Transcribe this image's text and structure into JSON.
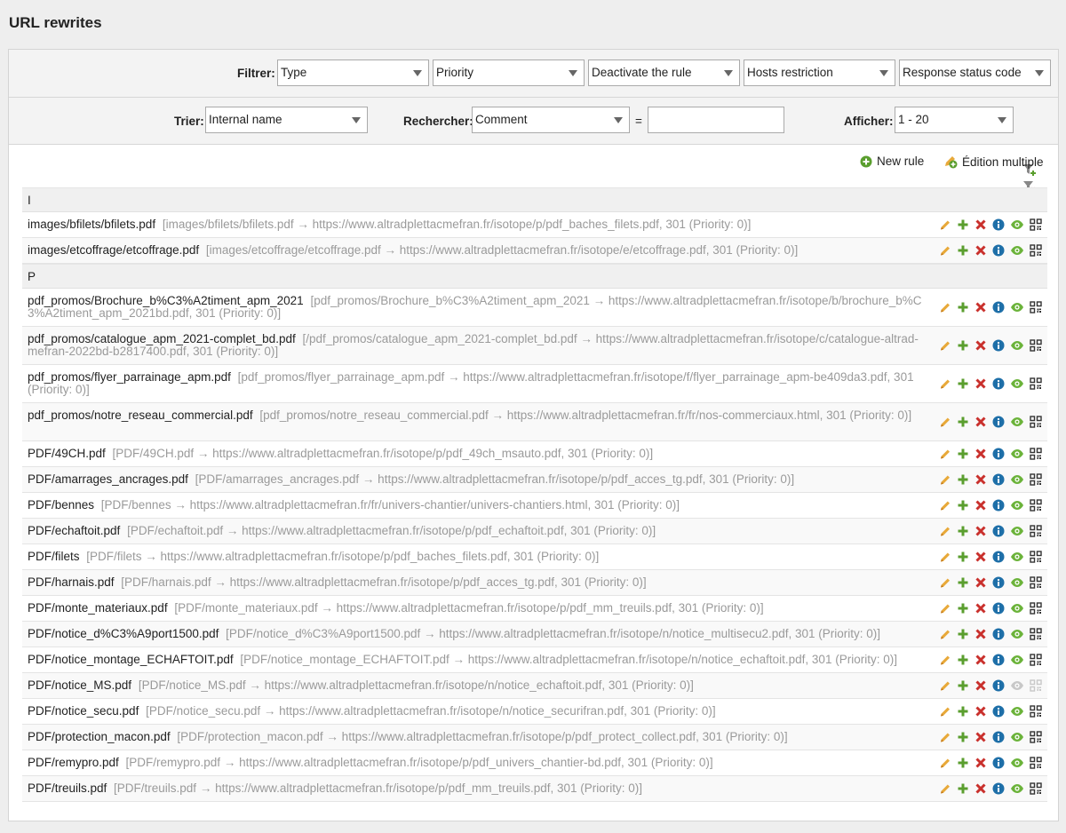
{
  "page": {
    "title": "URL rewrites"
  },
  "filter": {
    "label": "Filtrer:",
    "type": "Type",
    "priority": "Priority",
    "deactivate": "Deactivate the rule",
    "hosts": "Hosts restriction",
    "status": "Response status code"
  },
  "sortbar": {
    "sort_label": "Trier:",
    "sort_value": "Internal name",
    "search_label": "Rechercher:",
    "search_field": "Comment",
    "equals": "=",
    "search_value": "",
    "show_label": "Afficher:",
    "show_value": "1 - 20"
  },
  "actions": {
    "new_rule": "New rule",
    "multi_edit": "Édition multiple"
  },
  "groups": [
    {
      "header": "I",
      "rows": [
        {
          "src": "images/bfilets/bfilets.pdf",
          "desc": "[images/bfilets/bfilets.pdf → https://www.altradplettacmefran.fr/isotope/p/pdf_baches_filets.pdf, 301 (Priority: 0)]"
        },
        {
          "src": "images/etcoffrage/etcoffrage.pdf",
          "desc": "[images/etcoffrage/etcoffrage.pdf → https://www.altradplettacmefran.fr/isotope/e/etcoffrage.pdf, 301 (Priority: 0)]"
        }
      ]
    },
    {
      "header": "P",
      "rows": [
        {
          "src": "pdf_promos/Brochure_b%C3%A2timent_apm_2021",
          "desc": "[pdf_promos/Brochure_b%C3%A2timent_apm_2021 → https://www.altradplettacmefran.fr/isotope/b/brochure_b%C3%A2timent_apm_2021bd.pdf, 301 (Priority: 0)]"
        },
        {
          "src": "pdf_promos/catalogue_apm_2021-complet_bd.pdf",
          "desc": "[/pdf_promos/catalogue_apm_2021-complet_bd.pdf → https://www.altradplettacmefran.fr/isotope/c/catalogue-altrad-mefran-2022bd-b2817400.pdf, 301 (Priority: 0)]"
        },
        {
          "src": "pdf_promos/flyer_parrainage_apm.pdf",
          "desc": "[pdf_promos/flyer_parrainage_apm.pdf → https://www.altradplettacmefran.fr/isotope/f/flyer_parrainage_apm-be409da3.pdf, 301 (Priority: 0)]"
        },
        {
          "src": "pdf_promos/notre_reseau_commercial.pdf",
          "desc": "[pdf_promos/notre_reseau_commercial.pdf → https://www.altradplettacmefran.fr/fr/nos-commerciaux.html, 301 (Priority: 0)]"
        },
        {
          "src": "PDF/49CH.pdf",
          "desc": "[PDF/49CH.pdf → https://www.altradplettacmefran.fr/isotope/p/pdf_49ch_msauto.pdf, 301 (Priority: 0)]"
        },
        {
          "src": "PDF/amarrages_ancrages.pdf",
          "desc": "[PDF/amarrages_ancrages.pdf → https://www.altradplettacmefran.fr/isotope/p/pdf_acces_tg.pdf, 301 (Priority: 0)]"
        },
        {
          "src": "PDF/bennes",
          "desc": "[PDF/bennes → https://www.altradplettacmefran.fr/fr/univers-chantier/univers-chantiers.html, 301 (Priority: 0)]"
        },
        {
          "src": "PDF/echaftoit.pdf",
          "desc": "[PDF/echaftoit.pdf → https://www.altradplettacmefran.fr/isotope/p/pdf_echaftoit.pdf, 301 (Priority: 0)]"
        },
        {
          "src": "PDF/filets",
          "desc": "[PDF/filets → https://www.altradplettacmefran.fr/isotope/p/pdf_baches_filets.pdf, 301 (Priority: 0)]"
        },
        {
          "src": "PDF/harnais.pdf",
          "desc": "[PDF/harnais.pdf → https://www.altradplettacmefran.fr/isotope/p/pdf_acces_tg.pdf, 301 (Priority: 0)]"
        },
        {
          "src": "PDF/monte_materiaux.pdf",
          "desc": "[PDF/monte_materiaux.pdf → https://www.altradplettacmefran.fr/isotope/p/pdf_mm_treuils.pdf, 301 (Priority: 0)]"
        },
        {
          "src": "PDF/notice_d%C3%A9port1500.pdf",
          "desc": "[PDF/notice_d%C3%A9port1500.pdf → https://www.altradplettacmefran.fr/isotope/n/notice_multisecu2.pdf, 301 (Priority: 0)]"
        },
        {
          "src": "PDF/notice_montage_ECHAFTOIT.pdf",
          "desc": "[PDF/notice_montage_ECHAFTOIT.pdf → https://www.altradplettacmefran.fr/isotope/n/notice_echaftoit.pdf, 301 (Priority: 0)]"
        },
        {
          "src": "PDF/notice_MS.pdf",
          "desc": "[PDF/notice_MS.pdf → https://www.altradplettacmefran.fr/isotope/n/notice_echaftoit.pdf, 301 (Priority: 0)]",
          "disabled": true
        },
        {
          "src": "PDF/notice_secu.pdf",
          "desc": "[PDF/notice_secu.pdf → https://www.altradplettacmefran.fr/isotope/n/notice_securifran.pdf, 301 (Priority: 0)]"
        },
        {
          "src": "PDF/protection_macon.pdf",
          "desc": "[PDF/protection_macon.pdf → https://www.altradplettacmefran.fr/isotope/p/pdf_protect_collect.pdf, 301 (Priority: 0)]"
        },
        {
          "src": "PDF/remypro.pdf",
          "desc": "[PDF/remypro.pdf → https://www.altradplettacmefran.fr/isotope/p/pdf_univers_chantier-bd.pdf, 301 (Priority: 0)]"
        },
        {
          "src": "PDF/treuils.pdf",
          "desc": "[PDF/treuils.pdf → https://www.altradplettacmefran.fr/isotope/p/pdf_mm_treuils.pdf, 301 (Priority: 0)]"
        }
      ]
    }
  ],
  "icons": {
    "edit": "pencil-icon",
    "copy": "plus-icon",
    "delete": "delete-icon",
    "info": "info-icon",
    "toggle": "eye-icon",
    "qr": "qrcode-icon"
  },
  "colors": {
    "pencil": "#e8a93a",
    "plus": "#5a9e2e",
    "delete": "#c9302c",
    "info": "#1e6fa8",
    "eye": "#6bb33a"
  }
}
